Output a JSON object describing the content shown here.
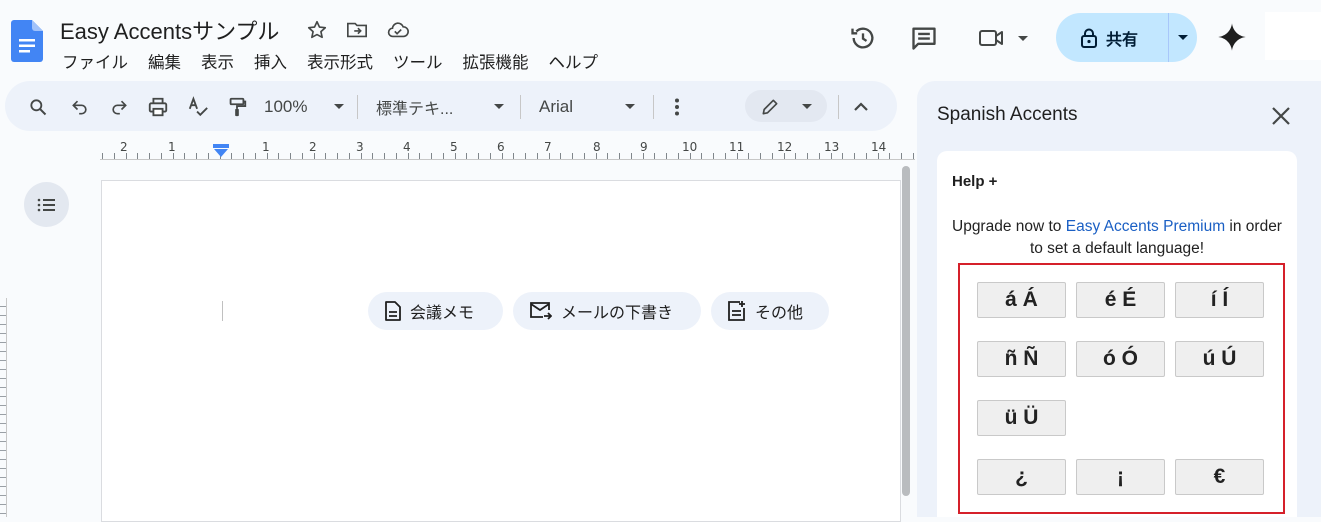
{
  "header": {
    "doc_title": "Easy Accentsサンプル",
    "menu": [
      "ファイル",
      "編集",
      "表示",
      "挿入",
      "表示形式",
      "ツール",
      "拡張機能",
      "ヘルプ"
    ],
    "share_label": "共有"
  },
  "toolbar": {
    "zoom": "100%",
    "style": "標準テキ...",
    "font": "Arial"
  },
  "ruler": {
    "labels": [
      "2",
      "1",
      "1",
      "2",
      "3",
      "4",
      "5",
      "6",
      "7",
      "8",
      "9",
      "10",
      "11",
      "12",
      "13",
      "14"
    ]
  },
  "chips": {
    "meeting_notes": "会議メモ",
    "email_draft": "メールの下書き",
    "more": "その他"
  },
  "side_panel": {
    "title": "Spanish Accents",
    "help": "Help +",
    "upgrade_prefix": "Upgrade now to ",
    "upgrade_link": "Easy Accents Premium",
    "upgrade_suffix": " in order to set a default language!",
    "keys": [
      [
        "á Á",
        "é É",
        "í Í"
      ],
      [
        "ñ Ñ",
        "ó Ó",
        "ú Ú"
      ],
      [
        "ü Ü"
      ],
      [
        "¿",
        "¡",
        "€"
      ]
    ]
  },
  "colors": {
    "share_bg": "#c2e7ff",
    "toolbar_bg": "#edf2fa",
    "highlight_box": "#d5202a",
    "link": "#1a5fc4",
    "docs_blue": "#4285f4"
  }
}
